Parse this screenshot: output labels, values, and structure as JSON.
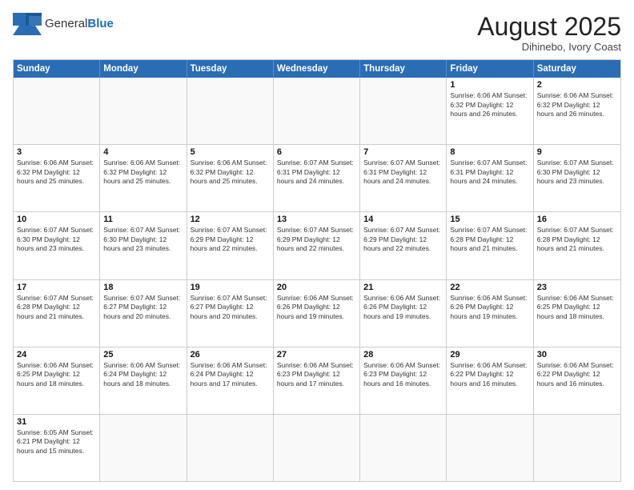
{
  "logo": {
    "general": "General",
    "blue": "Blue"
  },
  "header": {
    "month": "August 2025",
    "location": "Dihinebo, Ivory Coast"
  },
  "days_of_week": [
    "Sunday",
    "Monday",
    "Tuesday",
    "Wednesday",
    "Thursday",
    "Friday",
    "Saturday"
  ],
  "weeks": [
    [
      {
        "day": "",
        "info": ""
      },
      {
        "day": "",
        "info": ""
      },
      {
        "day": "",
        "info": ""
      },
      {
        "day": "",
        "info": ""
      },
      {
        "day": "",
        "info": ""
      },
      {
        "day": "1",
        "info": "Sunrise: 6:06 AM\nSunset: 6:32 PM\nDaylight: 12 hours\nand 26 minutes."
      },
      {
        "day": "2",
        "info": "Sunrise: 6:06 AM\nSunset: 6:32 PM\nDaylight: 12 hours\nand 26 minutes."
      }
    ],
    [
      {
        "day": "3",
        "info": "Sunrise: 6:06 AM\nSunset: 6:32 PM\nDaylight: 12 hours\nand 25 minutes."
      },
      {
        "day": "4",
        "info": "Sunrise: 6:06 AM\nSunset: 6:32 PM\nDaylight: 12 hours\nand 25 minutes."
      },
      {
        "day": "5",
        "info": "Sunrise: 6:06 AM\nSunset: 6:32 PM\nDaylight: 12 hours\nand 25 minutes."
      },
      {
        "day": "6",
        "info": "Sunrise: 6:07 AM\nSunset: 6:31 PM\nDaylight: 12 hours\nand 24 minutes."
      },
      {
        "day": "7",
        "info": "Sunrise: 6:07 AM\nSunset: 6:31 PM\nDaylight: 12 hours\nand 24 minutes."
      },
      {
        "day": "8",
        "info": "Sunrise: 6:07 AM\nSunset: 6:31 PM\nDaylight: 12 hours\nand 24 minutes."
      },
      {
        "day": "9",
        "info": "Sunrise: 6:07 AM\nSunset: 6:30 PM\nDaylight: 12 hours\nand 23 minutes."
      }
    ],
    [
      {
        "day": "10",
        "info": "Sunrise: 6:07 AM\nSunset: 6:30 PM\nDaylight: 12 hours\nand 23 minutes."
      },
      {
        "day": "11",
        "info": "Sunrise: 6:07 AM\nSunset: 6:30 PM\nDaylight: 12 hours\nand 23 minutes."
      },
      {
        "day": "12",
        "info": "Sunrise: 6:07 AM\nSunset: 6:29 PM\nDaylight: 12 hours\nand 22 minutes."
      },
      {
        "day": "13",
        "info": "Sunrise: 6:07 AM\nSunset: 6:29 PM\nDaylight: 12 hours\nand 22 minutes."
      },
      {
        "day": "14",
        "info": "Sunrise: 6:07 AM\nSunset: 6:29 PM\nDaylight: 12 hours\nand 22 minutes."
      },
      {
        "day": "15",
        "info": "Sunrise: 6:07 AM\nSunset: 6:28 PM\nDaylight: 12 hours\nand 21 minutes."
      },
      {
        "day": "16",
        "info": "Sunrise: 6:07 AM\nSunset: 6:28 PM\nDaylight: 12 hours\nand 21 minutes."
      }
    ],
    [
      {
        "day": "17",
        "info": "Sunrise: 6:07 AM\nSunset: 6:28 PM\nDaylight: 12 hours\nand 21 minutes."
      },
      {
        "day": "18",
        "info": "Sunrise: 6:07 AM\nSunset: 6:27 PM\nDaylight: 12 hours\nand 20 minutes."
      },
      {
        "day": "19",
        "info": "Sunrise: 6:07 AM\nSunset: 6:27 PM\nDaylight: 12 hours\nand 20 minutes."
      },
      {
        "day": "20",
        "info": "Sunrise: 6:06 AM\nSunset: 6:26 PM\nDaylight: 12 hours\nand 19 minutes."
      },
      {
        "day": "21",
        "info": "Sunrise: 6:06 AM\nSunset: 6:26 PM\nDaylight: 12 hours\nand 19 minutes."
      },
      {
        "day": "22",
        "info": "Sunrise: 6:06 AM\nSunset: 6:26 PM\nDaylight: 12 hours\nand 19 minutes."
      },
      {
        "day": "23",
        "info": "Sunrise: 6:06 AM\nSunset: 6:25 PM\nDaylight: 12 hours\nand 18 minutes."
      }
    ],
    [
      {
        "day": "24",
        "info": "Sunrise: 6:06 AM\nSunset: 6:25 PM\nDaylight: 12 hours\nand 18 minutes."
      },
      {
        "day": "25",
        "info": "Sunrise: 6:06 AM\nSunset: 6:24 PM\nDaylight: 12 hours\nand 18 minutes."
      },
      {
        "day": "26",
        "info": "Sunrise: 6:06 AM\nSunset: 6:24 PM\nDaylight: 12 hours\nand 17 minutes."
      },
      {
        "day": "27",
        "info": "Sunrise: 6:06 AM\nSunset: 6:23 PM\nDaylight: 12 hours\nand 17 minutes."
      },
      {
        "day": "28",
        "info": "Sunrise: 6:06 AM\nSunset: 6:23 PM\nDaylight: 12 hours\nand 16 minutes."
      },
      {
        "day": "29",
        "info": "Sunrise: 6:06 AM\nSunset: 6:22 PM\nDaylight: 12 hours\nand 16 minutes."
      },
      {
        "day": "30",
        "info": "Sunrise: 6:06 AM\nSunset: 6:22 PM\nDaylight: 12 hours\nand 16 minutes."
      }
    ],
    [
      {
        "day": "31",
        "info": "Sunrise: 6:05 AM\nSunset: 6:21 PM\nDaylight: 12 hours\nand 15 minutes."
      },
      {
        "day": "",
        "info": ""
      },
      {
        "day": "",
        "info": ""
      },
      {
        "day": "",
        "info": ""
      },
      {
        "day": "",
        "info": ""
      },
      {
        "day": "",
        "info": ""
      },
      {
        "day": "",
        "info": ""
      }
    ]
  ]
}
